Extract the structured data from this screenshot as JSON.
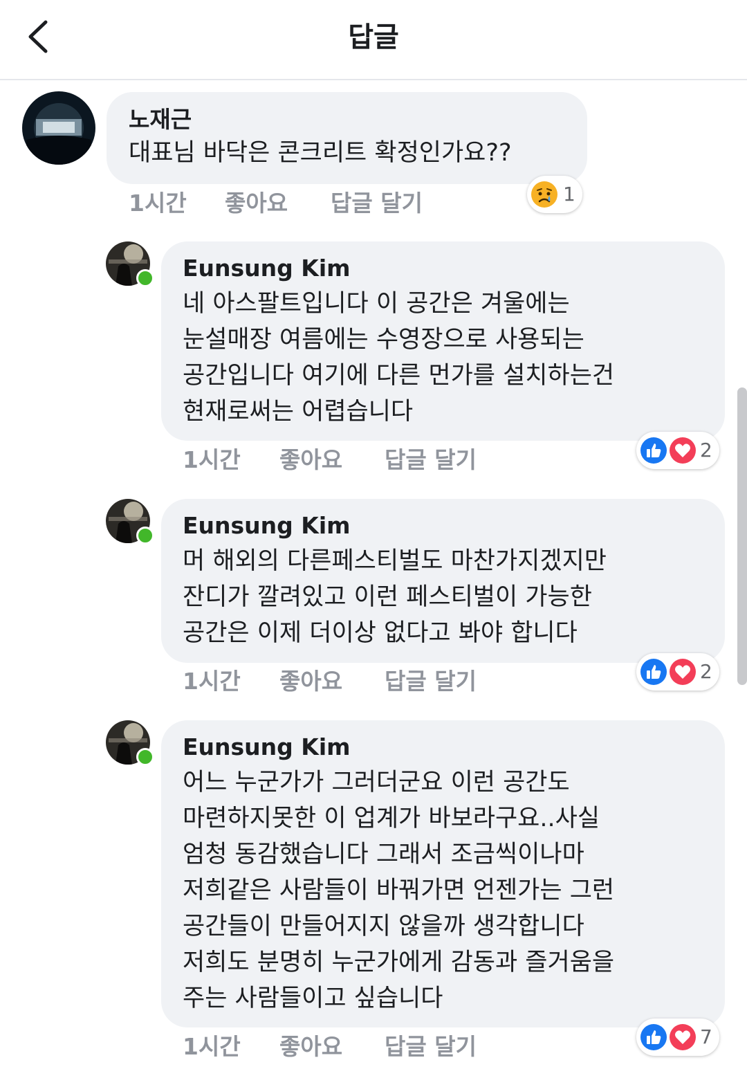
{
  "header": {
    "title": "답글"
  },
  "comments": [
    {
      "author": "노재근",
      "text": "대표님 바닥은 콘크리트 확정인가요??",
      "time": "1시간",
      "like_label": "좋아요",
      "reply_label": "답글 달기",
      "reactions": {
        "types": [
          "sad"
        ],
        "count": "1"
      }
    },
    {
      "author": "Eunsung Kim",
      "text": "네 아스팔트입니다 이 공간은 겨울에는\n눈설매장 여름에는 수영장으로 사용되는\n공간입니다 여기에 다른 먼가를 설치하는건\n현재로써는 어렵습니다",
      "time": "1시간",
      "like_label": "좋아요",
      "reply_label": "답글 달기",
      "reactions": {
        "types": [
          "like",
          "love"
        ],
        "count": "2"
      }
    },
    {
      "author": "Eunsung Kim",
      "text": "머 해외의 다른페스티벌도 마찬가지겠지만\n잔디가 깔려있고 이런 페스티벌이 가능한\n공간은 이제 더이상 없다고 봐야 합니다",
      "time": "1시간",
      "like_label": "좋아요",
      "reply_label": "답글 달기",
      "reactions": {
        "types": [
          "like",
          "love"
        ],
        "count": "2"
      }
    },
    {
      "author": "Eunsung Kim",
      "text": "어느 누군가가 그러더군요 이런 공간도\n마련하지못한 이 업계가 바보라구요..사실\n엄청 동감했습니다 그래서 조금씩이나마\n저희같은 사람들이 바꿔가면 언젠가는 그런\n공간들이 만들어지지 않을까 생각합니다\n저희도 분명히 누군가에게 감동과 즐거움을\n주는 사람들이고 싶습니다",
      "time": "1시간",
      "like_label": "좋아요",
      "reply_label": "답글 달기",
      "reactions": {
        "types": [
          "like",
          "love"
        ],
        "count": "7"
      }
    }
  ],
  "colors": {
    "like": "#1877f2",
    "love": "#f33e58",
    "online": "#42b72a",
    "bubble": "#f0f2f5"
  }
}
